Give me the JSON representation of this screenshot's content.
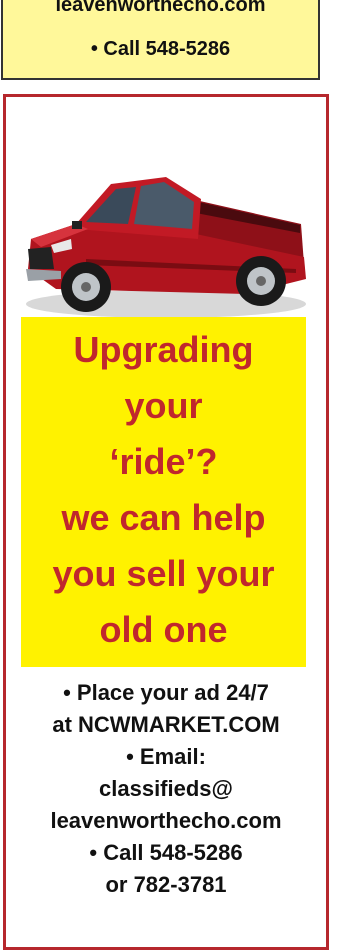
{
  "top_box": {
    "line1": "leavenworthecho.com",
    "line2": "• Call 548-5286"
  },
  "ad": {
    "headline": [
      "Upgrading",
      "your",
      "‘ride’?",
      "we can help",
      "you sell your",
      "old one"
    ],
    "contact": [
      "• Place your ad 24/7",
      "at NCWMARKET.COM",
      "• Email:",
      "classifieds@",
      "leavenworthecho.com",
      "• Call 548-5286",
      "or 782-3781"
    ],
    "image": "red-pickup-truck"
  },
  "colors": {
    "border": "#b6272d",
    "headline_text": "#c0272d",
    "headline_bg": "#fff200",
    "top_bg": "#fff89a"
  }
}
